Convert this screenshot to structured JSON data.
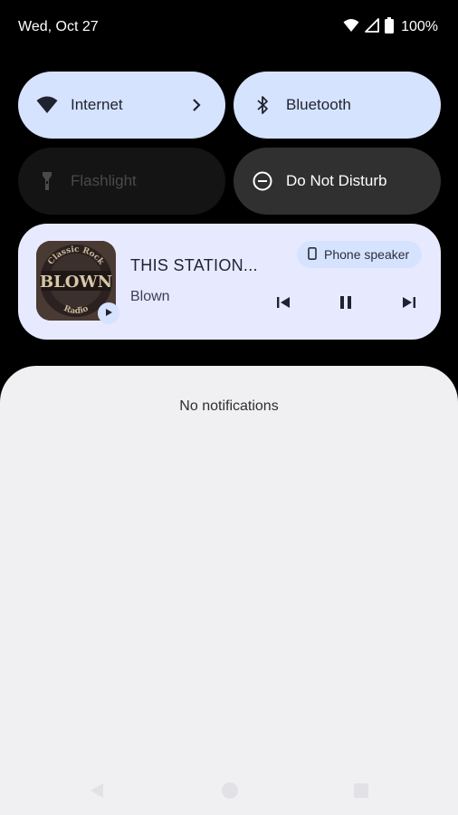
{
  "status_bar": {
    "date": "Wed, Oct 27",
    "battery": "100%",
    "icons": [
      "wifi-icon",
      "cellular-signal-icon",
      "battery-icon"
    ]
  },
  "quick_settings": {
    "tiles": [
      {
        "label": "Internet",
        "icon": "wifi-icon",
        "state": "on",
        "has_chevron": true
      },
      {
        "label": "Bluetooth",
        "icon": "bluetooth-icon",
        "state": "on"
      },
      {
        "label": "Flashlight",
        "icon": "flashlight-icon",
        "state": "unavailable"
      },
      {
        "label": "Do Not Disturb",
        "icon": "do-not-disturb-icon",
        "state": "off"
      }
    ]
  },
  "media": {
    "title": "THIS STATION...",
    "artist": "Blown",
    "output": "Phone speaker",
    "album_art": {
      "top_text": "Classic Rock",
      "main_text": "BLOWN",
      "bottom_text": "Radio"
    },
    "controls": [
      "previous-icon",
      "pause-icon",
      "next-icon"
    ]
  },
  "notifications": {
    "empty_text": "No notifications"
  },
  "navigation": [
    "back-icon",
    "home-icon",
    "recents-icon"
  ],
  "colors": {
    "tile_on": "#d6e3ff",
    "tile_off": "#303030",
    "media_card": "#e7eaff",
    "shade": "#f0f0f2"
  }
}
